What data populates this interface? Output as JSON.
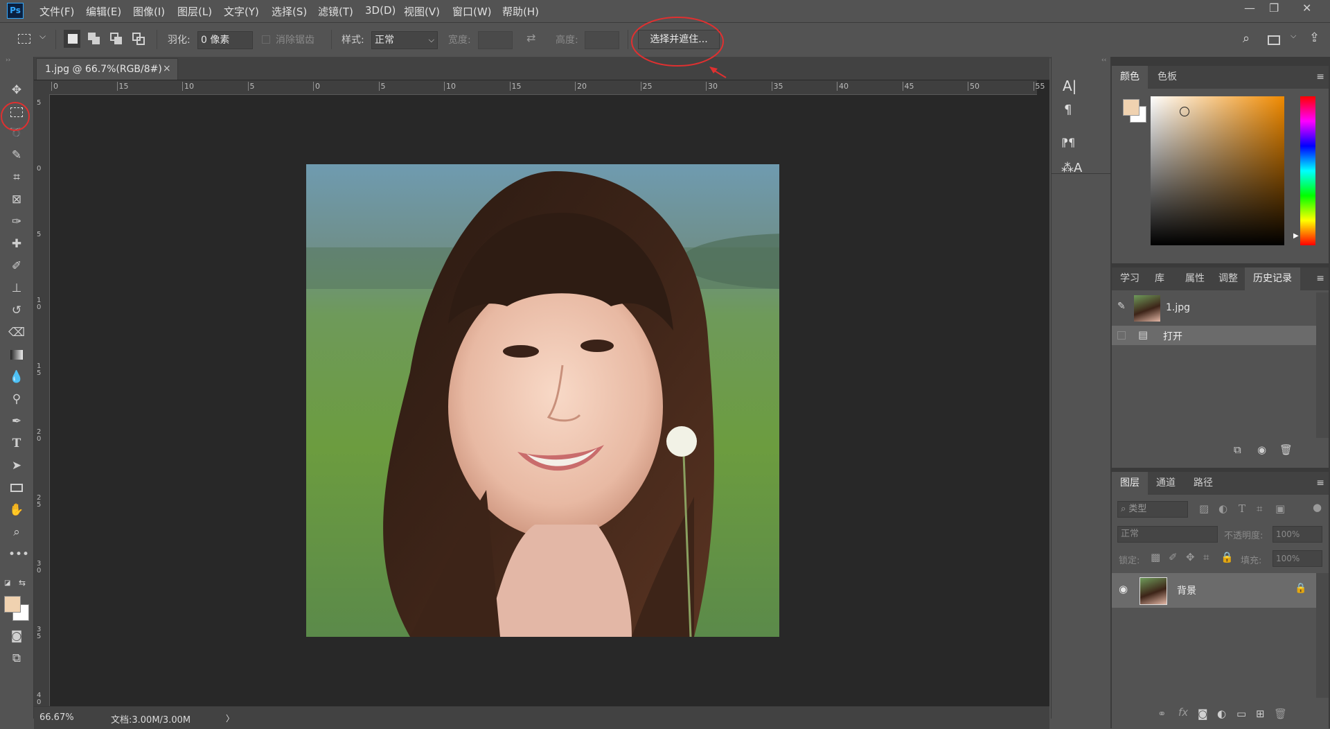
{
  "app": {
    "logo": "Ps"
  },
  "menu": [
    "文件(F)",
    "编辑(E)",
    "图像(I)",
    "图层(L)",
    "文字(Y)",
    "选择(S)",
    "滤镜(T)",
    "3D(D)",
    "视图(V)",
    "窗口(W)",
    "帮助(H)"
  ],
  "window_controls": {
    "minimize": "—",
    "restore": "❐",
    "close": "✕"
  },
  "options": {
    "feather_label": "羽化:",
    "feather_value": "0 像素",
    "antialias_label": "消除锯齿",
    "style_label": "样式:",
    "style_value": "正常",
    "width_label": "宽度:",
    "height_label": "高度:",
    "select_mask_button": "选择并遮住..."
  },
  "document": {
    "tab_title": "1.jpg @ 66.7%(RGB/8#)",
    "tab_close": "×",
    "ruler_top": [
      "0",
      "15",
      "10",
      "5",
      "0",
      "5",
      "10",
      "15",
      "20",
      "25",
      "30",
      "35",
      "40",
      "45",
      "50",
      "55"
    ],
    "ruler_left": [
      "5",
      "0",
      "5",
      "1\n0",
      "1\n5",
      "2\n0",
      "2\n5",
      "3\n0",
      "3\n5",
      "4\n0"
    ]
  },
  "status": {
    "zoom": "66.67%",
    "doc_info": "文档:3.00M/3.00M",
    "arrow": "〉"
  },
  "colors": {
    "foreground": "#f0d2b0",
    "background": "#ffffff",
    "accent_annotation": "#e03030"
  },
  "color_panel": {
    "tabs": [
      "颜色",
      "色板"
    ]
  },
  "history_panel": {
    "tabs": [
      "学习",
      "库",
      "属性",
      "调整",
      "历史记录"
    ],
    "snapshot_label": "1.jpg",
    "items": [
      "打开"
    ]
  },
  "layers_panel": {
    "tabs": [
      "图层",
      "通道",
      "路径"
    ],
    "filter_placeholder": "类型",
    "blend_mode": "正常",
    "opacity_label": "不透明度:",
    "opacity_value": "100%",
    "lock_label": "锁定:",
    "fill_label": "填充:",
    "fill_value": "100%",
    "layers": [
      {
        "name": "背景"
      }
    ]
  }
}
